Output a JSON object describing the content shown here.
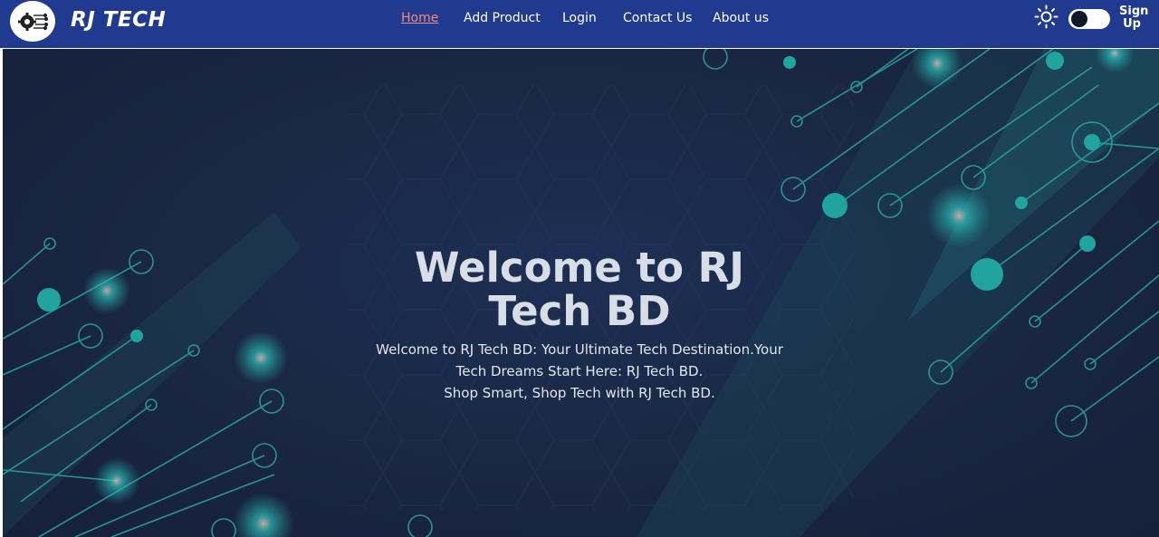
{
  "brand": {
    "logo_icon": "circuit-gear-icon",
    "name": "RJ TECH"
  },
  "nav": {
    "links": [
      {
        "label": "Home",
        "active": true
      },
      {
        "label": "Add Product",
        "active": false
      },
      {
        "label": "Login",
        "active": false
      },
      {
        "label": "Contact Us",
        "active": false
      },
      {
        "label": "About us",
        "active": false
      }
    ],
    "theme_icon": "sun-icon",
    "theme_toggle_on": false,
    "signup_line1": "Sign",
    "signup_line2": "Up"
  },
  "hero": {
    "title_line1": "Welcome to RJ",
    "title_line2": "Tech BD",
    "subtitle_line1": "Welcome to RJ Tech BD: Your Ultimate Tech Destination.Your",
    "subtitle_line2": "Tech Dreams Start Here: RJ Tech BD.",
    "subtitle_line3": "Shop Smart, Shop Tech with RJ Tech BD."
  },
  "colors": {
    "navbar": "#1f3a8e",
    "active_link": "#f28a7e",
    "hero_bg": "#1a2742",
    "circuit_teal": "#21a3a0"
  }
}
